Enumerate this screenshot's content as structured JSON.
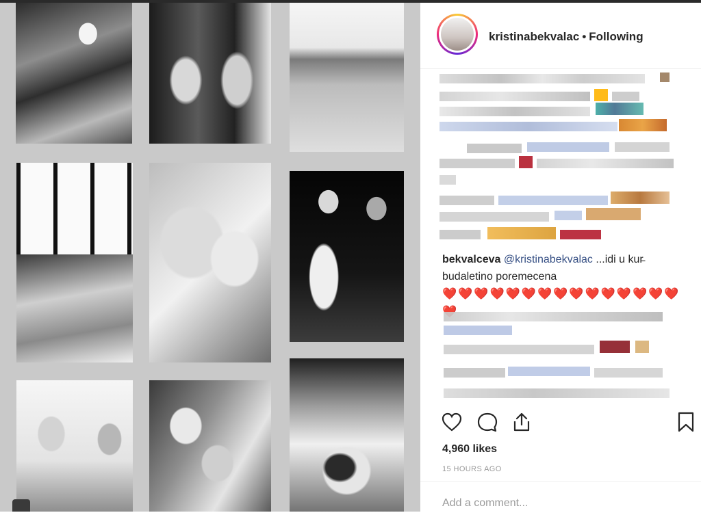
{
  "post": {
    "username": "kristinabekvalac",
    "follow_status": "Following",
    "likes": "4,960 likes",
    "time": "15 HOURS AGO"
  },
  "comment": {
    "author": "bekvalceva",
    "mention": "@kristinabekvalac",
    "text": " ...idi u kur̵ budaletino poremecena",
    "hearts": "❤️❤️❤️❤️❤️❤️❤️❤️❤️❤️❤️❤️❤️❤️❤️❤️"
  },
  "comment_input": {
    "placeholder": "Add a comment..."
  },
  "colors": {
    "link": "#385185",
    "muted": "#999999",
    "heart": "#c4001a"
  },
  "icons": [
    "heart-icon",
    "comment-icon",
    "share-icon",
    "bookmark-icon",
    "camera-icon"
  ]
}
